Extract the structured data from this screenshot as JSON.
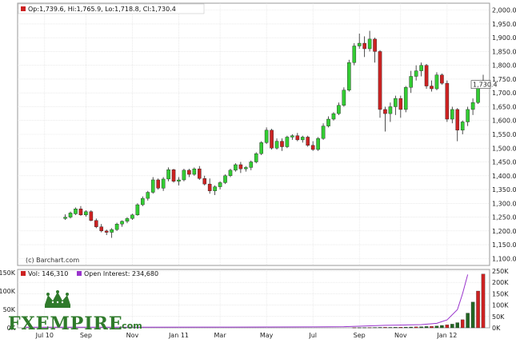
{
  "chart_data": [
    {
      "type": "candlestick",
      "info_line": "Op:1,739.6, Hi:1,765.9, Lo:1,718.8, Cl:1,730.4",
      "last_price_label": "1,730.4",
      "credit": "(c) Barchart.com",
      "ylim": [
        1075,
        2025
      ],
      "y_ticks": [
        "2,000.0",
        "1,950.0",
        "1,900.0",
        "1,850.0",
        "1,800.0",
        "1,750.0",
        "1,700.0",
        "1,650.0",
        "1,600.0",
        "1,550.0",
        "1,500.0",
        "1,450.0",
        "1,400.0",
        "1,350.0",
        "1,300.0",
        "1,250.0",
        "1,200.0",
        "1,150.0",
        "1,100.0"
      ],
      "y_tick_values": [
        2000,
        1950,
        1900,
        1850,
        1800,
        1750,
        1700,
        1650,
        1600,
        1550,
        1500,
        1450,
        1400,
        1350,
        1300,
        1250,
        1200,
        1150,
        1100
      ],
      "x_labels": [
        "Jul 10",
        "Sep",
        "Nov",
        "Jan 11",
        "Mar",
        "May",
        "Jul",
        "Sep",
        "Nov",
        "Jan 12"
      ],
      "x_label_week": [
        4,
        12,
        21,
        30,
        38,
        47,
        56,
        65,
        73,
        82
      ],
      "weeks_total": 90,
      "up_color": "#33cc33",
      "down_color": "#cc2222",
      "grid": true,
      "candles": [
        {
          "o": 1245,
          "h": 1260,
          "l": 1240,
          "c": 1250
        },
        {
          "o": 1250,
          "h": 1270,
          "l": 1245,
          "c": 1265
        },
        {
          "o": 1262,
          "h": 1285,
          "l": 1258,
          "c": 1280
        },
        {
          "o": 1280,
          "h": 1290,
          "l": 1255,
          "c": 1258
        },
        {
          "o": 1258,
          "h": 1275,
          "l": 1252,
          "c": 1270
        },
        {
          "o": 1270,
          "h": 1275,
          "l": 1235,
          "c": 1238
        },
        {
          "o": 1238,
          "h": 1245,
          "l": 1210,
          "c": 1215
        },
        {
          "o": 1215,
          "h": 1225,
          "l": 1195,
          "c": 1200
        },
        {
          "o": 1200,
          "h": 1205,
          "l": 1185,
          "c": 1195
        },
        {
          "o": 1195,
          "h": 1210,
          "l": 1175,
          "c": 1205
        },
        {
          "o": 1205,
          "h": 1230,
          "l": 1200,
          "c": 1225
        },
        {
          "o": 1225,
          "h": 1238,
          "l": 1215,
          "c": 1235
        },
        {
          "o": 1235,
          "h": 1250,
          "l": 1228,
          "c": 1245
        },
        {
          "o": 1245,
          "h": 1262,
          "l": 1240,
          "c": 1258
        },
        {
          "o": 1258,
          "h": 1300,
          "l": 1255,
          "c": 1295
        },
        {
          "o": 1295,
          "h": 1325,
          "l": 1290,
          "c": 1318
        },
        {
          "o": 1318,
          "h": 1345,
          "l": 1310,
          "c": 1340
        },
        {
          "o": 1340,
          "h": 1395,
          "l": 1335,
          "c": 1385
        },
        {
          "o": 1385,
          "h": 1390,
          "l": 1350,
          "c": 1355
        },
        {
          "o": 1355,
          "h": 1395,
          "l": 1345,
          "c": 1388
        },
        {
          "o": 1388,
          "h": 1430,
          "l": 1380,
          "c": 1422
        },
        {
          "o": 1422,
          "h": 1425,
          "l": 1375,
          "c": 1380
        },
        {
          "o": 1380,
          "h": 1395,
          "l": 1365,
          "c": 1385
        },
        {
          "o": 1385,
          "h": 1425,
          "l": 1380,
          "c": 1420
        },
        {
          "o": 1420,
          "h": 1425,
          "l": 1395,
          "c": 1405
        },
        {
          "o": 1405,
          "h": 1430,
          "l": 1400,
          "c": 1425
        },
        {
          "o": 1425,
          "h": 1435,
          "l": 1385,
          "c": 1390
        },
        {
          "o": 1390,
          "h": 1400,
          "l": 1365,
          "c": 1370
        },
        {
          "o": 1370,
          "h": 1390,
          "l": 1335,
          "c": 1345
        },
        {
          "o": 1345,
          "h": 1365,
          "l": 1330,
          "c": 1360
        },
        {
          "o": 1360,
          "h": 1380,
          "l": 1350,
          "c": 1375
        },
        {
          "o": 1375,
          "h": 1405,
          "l": 1370,
          "c": 1400
        },
        {
          "o": 1400,
          "h": 1425,
          "l": 1395,
          "c": 1420
        },
        {
          "o": 1420,
          "h": 1445,
          "l": 1415,
          "c": 1440
        },
        {
          "o": 1440,
          "h": 1450,
          "l": 1410,
          "c": 1425
        },
        {
          "o": 1425,
          "h": 1435,
          "l": 1415,
          "c": 1430
        },
        {
          "o": 1430,
          "h": 1455,
          "l": 1420,
          "c": 1450
        },
        {
          "o": 1450,
          "h": 1485,
          "l": 1445,
          "c": 1480
        },
        {
          "o": 1480,
          "h": 1525,
          "l": 1475,
          "c": 1520
        },
        {
          "o": 1520,
          "h": 1575,
          "l": 1515,
          "c": 1565
        },
        {
          "o": 1565,
          "h": 1570,
          "l": 1495,
          "c": 1500
        },
        {
          "o": 1500,
          "h": 1535,
          "l": 1495,
          "c": 1525
        },
        {
          "o": 1525,
          "h": 1535,
          "l": 1490,
          "c": 1505
        },
        {
          "o": 1505,
          "h": 1545,
          "l": 1500,
          "c": 1540
        },
        {
          "o": 1540,
          "h": 1550,
          "l": 1530,
          "c": 1545
        },
        {
          "o": 1545,
          "h": 1555,
          "l": 1525,
          "c": 1530
        },
        {
          "o": 1530,
          "h": 1545,
          "l": 1520,
          "c": 1540
        },
        {
          "o": 1540,
          "h": 1545,
          "l": 1505,
          "c": 1510
        },
        {
          "o": 1510,
          "h": 1525,
          "l": 1490,
          "c": 1495
        },
        {
          "o": 1495,
          "h": 1540,
          "l": 1490,
          "c": 1535
        },
        {
          "o": 1535,
          "h": 1590,
          "l": 1530,
          "c": 1580
        },
        {
          "o": 1580,
          "h": 1615,
          "l": 1575,
          "c": 1605
        },
        {
          "o": 1605,
          "h": 1630,
          "l": 1600,
          "c": 1625
        },
        {
          "o": 1625,
          "h": 1665,
          "l": 1620,
          "c": 1655
        },
        {
          "o": 1655,
          "h": 1720,
          "l": 1650,
          "c": 1710
        },
        {
          "o": 1710,
          "h": 1820,
          "l": 1705,
          "c": 1810
        },
        {
          "o": 1810,
          "h": 1880,
          "l": 1800,
          "c": 1870
        },
        {
          "o": 1870,
          "h": 1915,
          "l": 1860,
          "c": 1880
        },
        {
          "o": 1880,
          "h": 1905,
          "l": 1830,
          "c": 1860
        },
        {
          "o": 1860,
          "h": 1925,
          "l": 1850,
          "c": 1895
        },
        {
          "o": 1895,
          "h": 1900,
          "l": 1810,
          "c": 1850
        },
        {
          "o": 1850,
          "h": 1855,
          "l": 1610,
          "c": 1640
        },
        {
          "o": 1640,
          "h": 1650,
          "l": 1560,
          "c": 1625
        },
        {
          "o": 1625,
          "h": 1665,
          "l": 1595,
          "c": 1650
        },
        {
          "o": 1650,
          "h": 1690,
          "l": 1620,
          "c": 1680
        },
        {
          "o": 1680,
          "h": 1690,
          "l": 1610,
          "c": 1640
        },
        {
          "o": 1640,
          "h": 1725,
          "l": 1630,
          "c": 1720
        },
        {
          "o": 1720,
          "h": 1780,
          "l": 1700,
          "c": 1760
        },
        {
          "o": 1760,
          "h": 1800,
          "l": 1745,
          "c": 1780
        },
        {
          "o": 1780,
          "h": 1810,
          "l": 1760,
          "c": 1800
        },
        {
          "o": 1800,
          "h": 1805,
          "l": 1715,
          "c": 1725
        },
        {
          "o": 1725,
          "h": 1745,
          "l": 1705,
          "c": 1715
        },
        {
          "o": 1715,
          "h": 1775,
          "l": 1710,
          "c": 1765
        },
        {
          "o": 1765,
          "h": 1770,
          "l": 1730,
          "c": 1735
        },
        {
          "o": 1735,
          "h": 1745,
          "l": 1595,
          "c": 1605
        },
        {
          "o": 1605,
          "h": 1650,
          "l": 1590,
          "c": 1640
        },
        {
          "o": 1640,
          "h": 1645,
          "l": 1525,
          "c": 1565
        },
        {
          "o": 1565,
          "h": 1600,
          "l": 1550,
          "c": 1595
        },
        {
          "o": 1595,
          "h": 1650,
          "l": 1580,
          "c": 1640
        },
        {
          "o": 1640,
          "h": 1680,
          "l": 1620,
          "c": 1665
        },
        {
          "o": 1665,
          "h": 1740,
          "l": 1660,
          "c": 1735
        },
        {
          "o": 1739.6,
          "h": 1765.9,
          "l": 1718.8,
          "c": 1730.4
        }
      ]
    },
    {
      "type": "bar",
      "vol_label": "Vol: 146,310",
      "oi_label": "Open Interest: 234,680",
      "vol_color": "#cc2222",
      "oi_color": "#9933cc",
      "left_ticks": [
        "150K",
        "100K",
        "50K",
        "0K"
      ],
      "left_tick_values": [
        150000,
        100000,
        50000,
        0
      ],
      "right_ticks": [
        "250K",
        "200K",
        "150K",
        "100K",
        "50K",
        "0K"
      ],
      "right_tick_values": [
        250000,
        200000,
        150000,
        100000,
        50000,
        0
      ],
      "ylim_left": [
        0,
        150000
      ],
      "ylim_right": [
        0,
        250000
      ],
      "volume_recent": [
        500,
        600,
        800,
        900,
        1000,
        1200,
        1400,
        1200,
        1500,
        1800,
        2000,
        2200,
        2500,
        3000,
        3500,
        4000,
        5000,
        6500,
        8000,
        10000,
        14000,
        22000,
        40000,
        70000,
        100000,
        146310
      ],
      "open_interest": [
        {
          "w": 0,
          "v": 2500
        },
        {
          "w": 20,
          "v": 2800
        },
        {
          "w": 40,
          "v": 3200
        },
        {
          "w": 56,
          "v": 4000
        },
        {
          "w": 62,
          "v": 5000
        },
        {
          "w": 66,
          "v": 8000
        },
        {
          "w": 70,
          "v": 11000
        },
        {
          "w": 74,
          "v": 12500
        },
        {
          "w": 77,
          "v": 14000
        },
        {
          "w": 80,
          "v": 20000
        },
        {
          "w": 82,
          "v": 35000
        },
        {
          "w": 84,
          "v": 80000
        },
        {
          "w": 85,
          "v": 150000
        },
        {
          "w": 86,
          "v": 234680
        }
      ]
    }
  ],
  "logo": {
    "name": "FXEMPIRE",
    "suffix": ".com"
  }
}
